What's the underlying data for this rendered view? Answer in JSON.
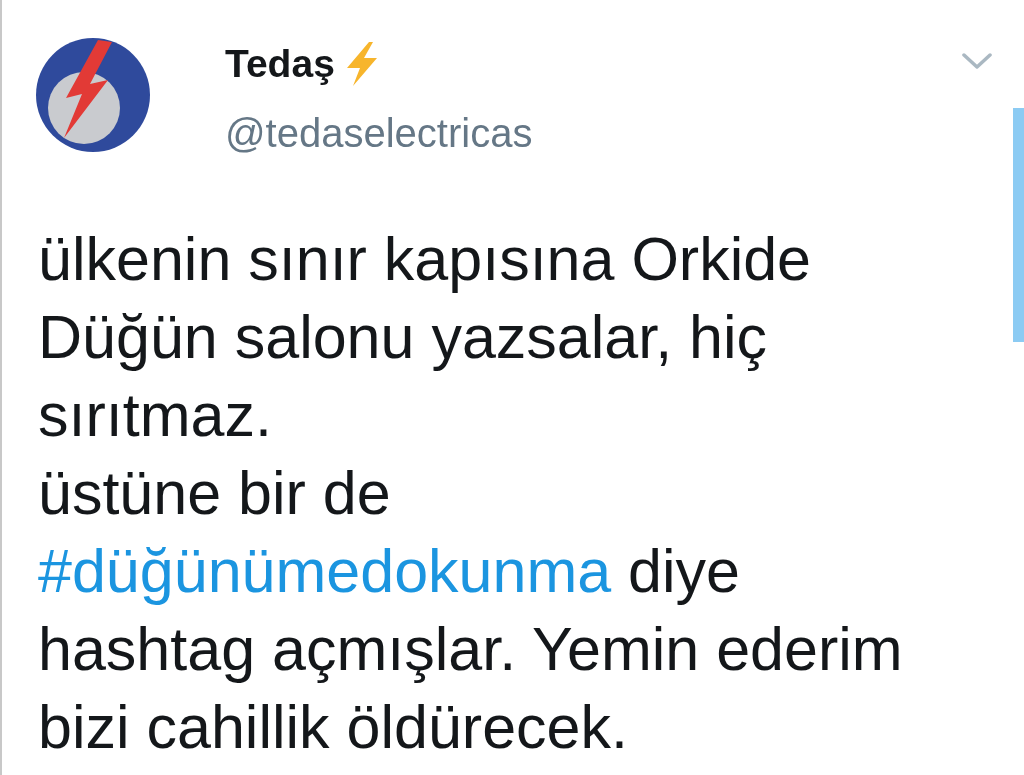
{
  "tweet": {
    "author": {
      "name": "Tedaş",
      "handle": "@tedaselectricas"
    },
    "paragraphs": [
      {
        "segments": [
          {
            "kind": "text",
            "text": "ülkenin sınır kapısına Orkide Düğün salonu yazsalar, hiç sırıtmaz."
          }
        ]
      },
      {
        "segments": [
          {
            "kind": "text",
            "text": "üstüne bir de "
          },
          {
            "kind": "hashtag",
            "text": "#düğünümedokunma"
          },
          {
            "kind": "text",
            "text": " diye hashtag açmışlar. Yemin ederim bizi cahillik öldürecek."
          }
        ]
      }
    ]
  }
}
